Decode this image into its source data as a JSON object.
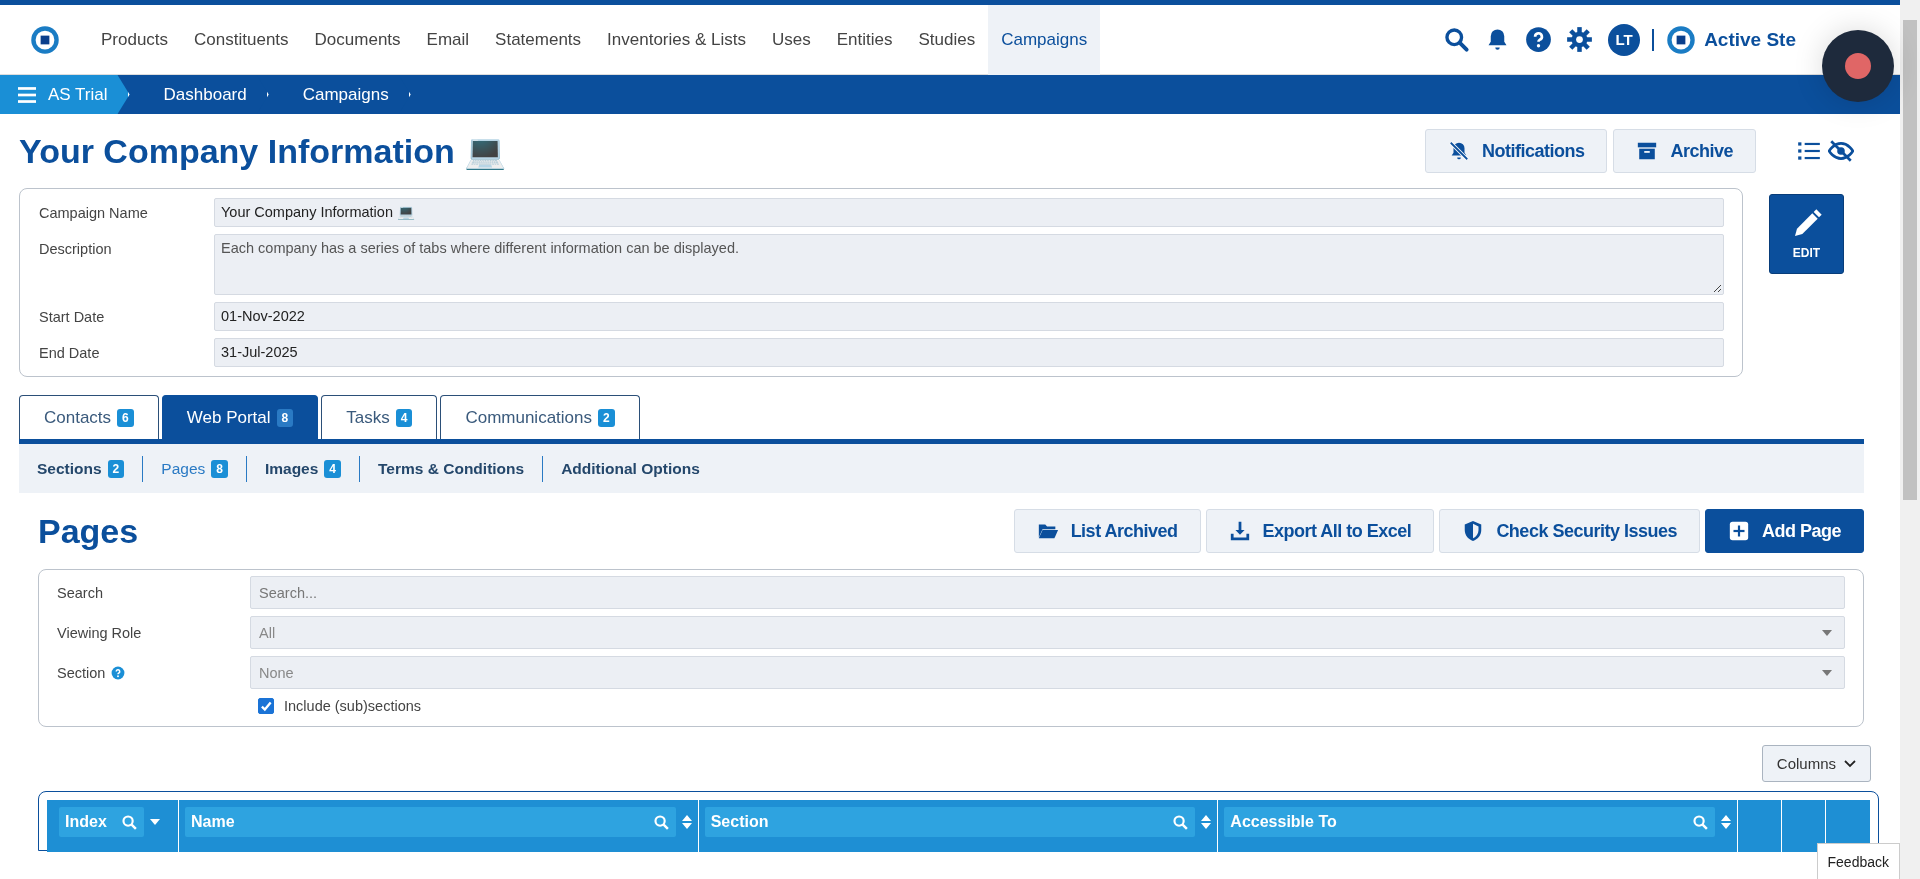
{
  "nav": {
    "items": [
      {
        "label": "Products",
        "selected": false
      },
      {
        "label": "Constituents",
        "selected": false
      },
      {
        "label": "Documents",
        "selected": false
      },
      {
        "label": "Email",
        "selected": false
      },
      {
        "label": "Statements",
        "selected": false
      },
      {
        "label": "Inventories & Lists",
        "selected": false
      },
      {
        "label": "Uses",
        "selected": false
      },
      {
        "label": "Entities",
        "selected": false
      },
      {
        "label": "Studies",
        "selected": false
      },
      {
        "label": "Campaigns",
        "selected": true
      }
    ],
    "avatar": "LT",
    "brand": "Active Ste"
  },
  "breadcrumb": [
    "AS Trial",
    "Dashboard",
    "Campaigns"
  ],
  "title": "Your Company Information 💻",
  "header_buttons": [
    "Notifications",
    "Archive"
  ],
  "edit_button": "EDIT",
  "details": [
    {
      "label": "Campaign Name",
      "value": "Your Company Information 💻",
      "kind": "line"
    },
    {
      "label": "Description",
      "value": "Each company has a series of tabs where different information can be displayed.",
      "kind": "area"
    },
    {
      "label": "Start Date",
      "value": "01-Nov-2022",
      "kind": "line"
    },
    {
      "label": "End Date",
      "value": "31-Jul-2025",
      "kind": "line"
    }
  ],
  "tabs": [
    {
      "label": "Contacts",
      "count": "6",
      "selected": false
    },
    {
      "label": "Web Portal",
      "count": "8",
      "selected": true
    },
    {
      "label": "Tasks",
      "count": "4",
      "selected": false
    },
    {
      "label": "Communications",
      "count": "2",
      "selected": false
    }
  ],
  "subtabs": [
    {
      "label": "Sections",
      "count": "2",
      "selected": false
    },
    {
      "label": "Pages",
      "count": "8",
      "selected": true
    },
    {
      "label": "Images",
      "count": "4",
      "selected": false
    },
    {
      "label": "Terms & Conditions",
      "selected": false
    },
    {
      "label": "Additional Options",
      "selected": false
    }
  ],
  "section_title": "Pages",
  "actions": [
    {
      "label": "List Archived",
      "kind": "folder"
    },
    {
      "label": "Export All to Excel",
      "kind": "download"
    },
    {
      "label": "Check Security Issues",
      "kind": "shield"
    },
    {
      "label": "Add Page",
      "kind": "add"
    }
  ],
  "filters": [
    {
      "label": "Search",
      "placeholder": "Search...",
      "kind": "text",
      "help": false
    },
    {
      "label": "Viewing Role",
      "placeholder": "All",
      "kind": "select",
      "help": false
    },
    {
      "label": "Section",
      "placeholder": "None",
      "kind": "select",
      "help": true
    }
  ],
  "include_subsections": {
    "label": "Include (sub)sections",
    "checked": true
  },
  "columns_button": "Columns",
  "table": {
    "columns": [
      {
        "label": "Index",
        "kind": "index"
      },
      {
        "label": "Name",
        "kind": "wide"
      },
      {
        "label": "Section",
        "kind": "wide"
      },
      {
        "label": "Accessible To",
        "kind": "wide"
      },
      {
        "kind": "blank"
      },
      {
        "kind": "blank"
      },
      {
        "kind": "blank"
      }
    ]
  },
  "feedback": "Feedback"
}
